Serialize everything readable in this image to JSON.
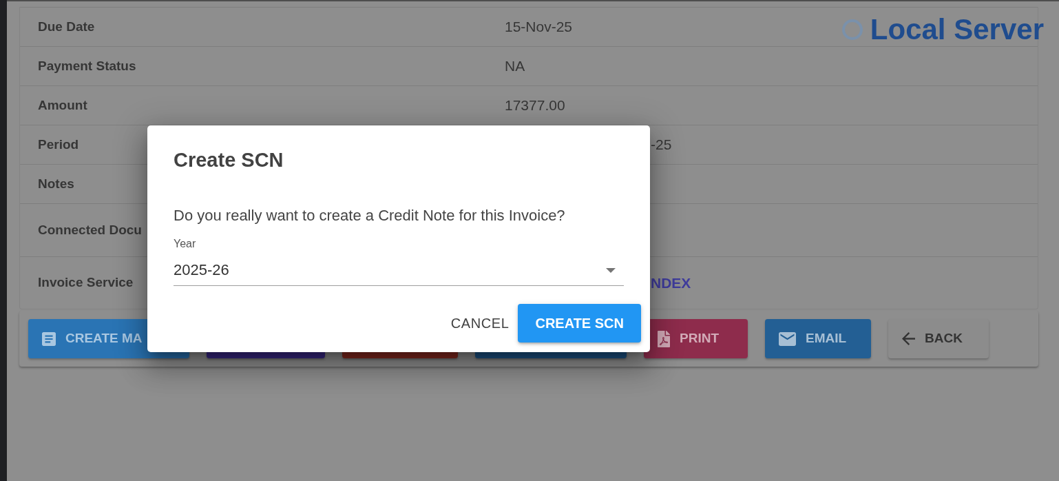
{
  "server_badge": {
    "label": "Local Server"
  },
  "details": {
    "rows": [
      {
        "label": "Due Date",
        "value": "15-Nov-25"
      },
      {
        "label": "Payment Status",
        "value": "NA"
      },
      {
        "label": "Amount",
        "value": "17377.00"
      },
      {
        "label": "Period",
        "value": "-25"
      },
      {
        "label": "Notes"
      },
      {
        "label": "Connected Docu"
      },
      {
        "label": "Invoice Service",
        "link": "NDEX"
      }
    ]
  },
  "actions": [
    {
      "kind": "create",
      "label": "CREATE MA"
    },
    {
      "kind": "plain"
    },
    {
      "kind": "plain"
    },
    {
      "kind": "plain"
    },
    {
      "kind": "print",
      "label": "PRINT"
    },
    {
      "kind": "email",
      "label": "EMAIL"
    },
    {
      "kind": "back",
      "label": "BACK"
    }
  ],
  "dialog": {
    "title": "Create SCN",
    "message": "Do you really want to create a Credit Note for this Invoice?",
    "year_select": {
      "label": "Year",
      "value": "2025-26"
    },
    "buttons": [
      {
        "kind": "text",
        "label": "CANCEL"
      },
      {
        "kind": "contained",
        "label": "CREATE SCN"
      }
    ]
  }
}
